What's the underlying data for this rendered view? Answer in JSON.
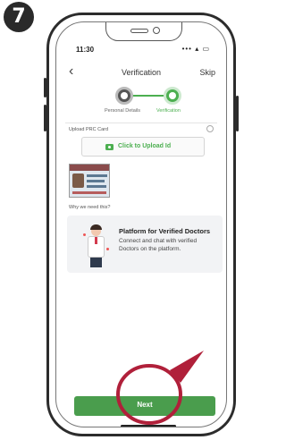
{
  "step_number": "7",
  "status_bar": {
    "time": "11:30",
    "icons": "••• ▴ ▭"
  },
  "nav": {
    "back_glyph": "‹",
    "title": "Verification",
    "skip_label": "Skip"
  },
  "stepper": {
    "step1_label": "Personal Details",
    "step2_label": "Verification"
  },
  "upload": {
    "label": "Upload PRC Card",
    "button_label": "Click to Upload Id"
  },
  "why_label": "Why we need this?",
  "info_card": {
    "title": "Platform for Verified Doctors",
    "description": "Connect and chat with verified Doctors on the platform."
  },
  "next_button": {
    "label": "Next"
  },
  "colors": {
    "accent_green": "#4caf50",
    "button_green": "#4a9d4d",
    "highlight_red": "#b0203a"
  }
}
